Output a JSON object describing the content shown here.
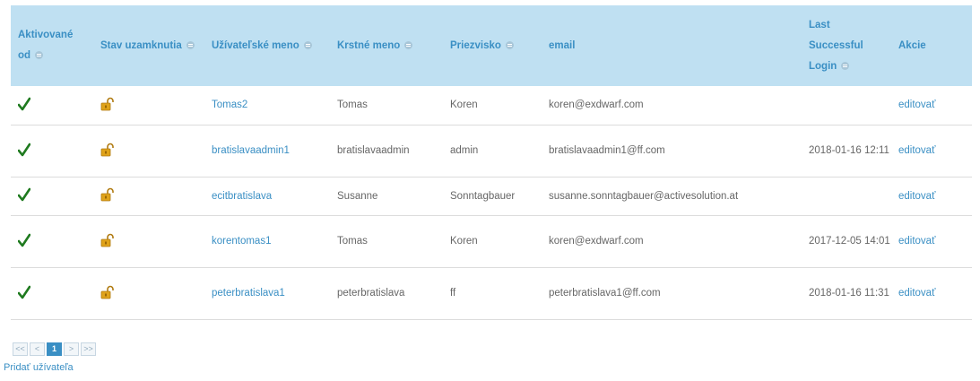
{
  "table": {
    "headers": [
      {
        "label": "Aktivované od",
        "sortable": true
      },
      {
        "label": "Stav uzamknutia",
        "sortable": true
      },
      {
        "label": "Užívateľské meno",
        "sortable": true
      },
      {
        "label": "Krstné meno",
        "sortable": true
      },
      {
        "label": "Priezvisko",
        "sortable": true
      },
      {
        "label": "email",
        "sortable": false
      },
      {
        "label": "Last Successful Login",
        "sortable": true
      },
      {
        "label": "Akcie",
        "sortable": false
      }
    ],
    "rows": [
      {
        "activated_icon": "checkmark-icon",
        "lock_icon": "unlocked-padlock-icon",
        "username": "Tomas2",
        "first_name": "Tomas",
        "last_name": "Koren",
        "email": "koren@exdwarf.com",
        "last_login": "",
        "action": "editovať"
      },
      {
        "activated_icon": "checkmark-icon",
        "lock_icon": "unlocked-padlock-icon",
        "username": "bratislavaadmin1",
        "first_name": "bratislavaadmin",
        "last_name": "admin",
        "email": "bratislavaadmin1@ff.com",
        "last_login": "2018-01-16 12:11",
        "action": "editovať"
      },
      {
        "activated_icon": "checkmark-icon",
        "lock_icon": "unlocked-padlock-icon",
        "username": "ecitbratislava",
        "first_name": "Susanne",
        "last_name": "Sonntagbauer",
        "email": "susanne.sonntagbauer@activesolution.at",
        "last_login": "",
        "action": "editovať"
      },
      {
        "activated_icon": "checkmark-icon",
        "lock_icon": "unlocked-padlock-icon",
        "username": "korentomas1",
        "first_name": "Tomas",
        "last_name": "Koren",
        "email": "koren@exdwarf.com",
        "last_login": "2017-12-05 14:01",
        "action": "editovať"
      },
      {
        "activated_icon": "checkmark-icon",
        "lock_icon": "unlocked-padlock-icon",
        "username": "peterbratislava1",
        "first_name": "peterbratislava",
        "last_name": "ff",
        "email": "peterbratislava1@ff.com",
        "last_login": "2018-01-16 11:31",
        "action": "editovať"
      }
    ]
  },
  "pagination": {
    "first": "<<",
    "prev": "<",
    "current": "1",
    "next": ">",
    "last": ">>"
  },
  "add_user_label": "Pridať užívateľa",
  "colors": {
    "header_bg": "#bfe0f2",
    "link": "#3a8fc4",
    "check": "#1f7a1f",
    "lock": "#e0a31a"
  }
}
